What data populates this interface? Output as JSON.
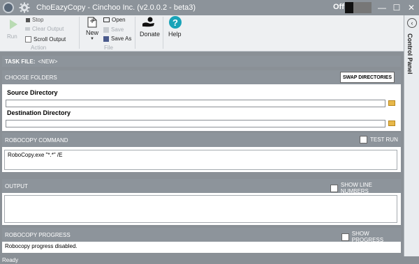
{
  "window": {
    "title": "ChoEazyCopy - Cinchoo Inc. (v2.0.0.2 - beta3)",
    "toggle_label": "Off",
    "minimize": "—",
    "maximize": "☐",
    "close": "✕"
  },
  "ribbon": {
    "run_label": "Run",
    "stop_label": "Stop",
    "clear_output_label": "Clear Output",
    "scroll_output_label": "Scroll Output",
    "action_group": "Action",
    "new_label": "New",
    "open_label": "Open",
    "save_label": "Save",
    "save_as_label": "Save As",
    "file_group": "File",
    "donate_label": "Donate",
    "help_label": "Help"
  },
  "side_panel": {
    "label": "Control Panel"
  },
  "task": {
    "label": "TASK FILE:",
    "value": "<NEW>"
  },
  "choose_folders": {
    "header": "CHOOSE FOLDERS",
    "swap_button": "SWAP DIRECTORIES",
    "source_label": "Source Directory",
    "source_value": "",
    "destination_label": "Destination Directory",
    "destination_value": ""
  },
  "robocopy_command": {
    "header": "ROBOCOPY COMMAND",
    "test_run_label": "TEST RUN",
    "command_text": "RoboCopy.exe  \"*.*\" /E"
  },
  "output": {
    "header": "OUTPUT",
    "line_numbers_label": "SHOW LINE NUMBERS"
  },
  "progress": {
    "header": "ROBOCOPY PROGRESS",
    "show_progress_label": "SHOW PROGRESS",
    "status_text": "Robocopy progress disabled."
  },
  "status_bar": {
    "text": "Ready"
  }
}
